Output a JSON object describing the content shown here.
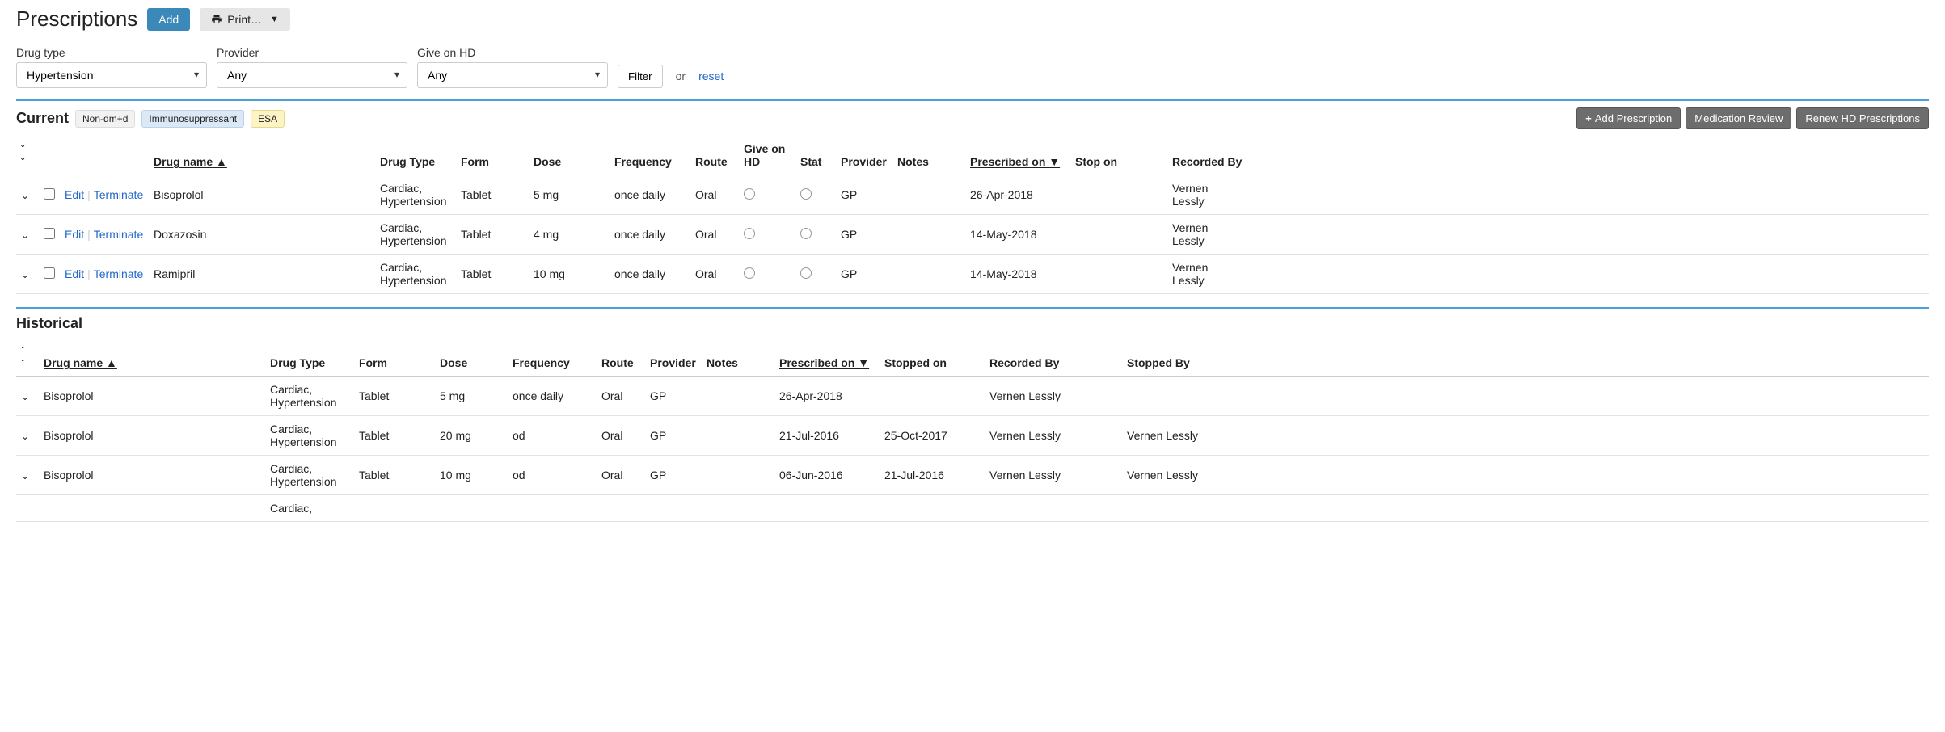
{
  "header": {
    "title": "Prescriptions",
    "add_label": "Add",
    "print_label": "Print…"
  },
  "filters": {
    "drug_type": {
      "label": "Drug type",
      "value": "Hypertension"
    },
    "provider": {
      "label": "Provider",
      "value": "Any"
    },
    "give_on_hd": {
      "label": "Give on HD",
      "value": "Any"
    },
    "filter_btn": "Filter",
    "or": "or",
    "reset": "reset"
  },
  "current": {
    "title": "Current",
    "pills": [
      "Non-dm+d",
      "Immunosuppressant",
      "ESA"
    ],
    "actions": {
      "add": "Add Prescription",
      "review": "Medication Review",
      "renew": "Renew HD Prescriptions"
    },
    "columns": {
      "drug_name": "Drug name ▲",
      "drug_type": "Drug Type",
      "form": "Form",
      "dose": "Dose",
      "frequency": "Frequency",
      "route": "Route",
      "give_on_hd": "Give on HD",
      "stat": "Stat",
      "provider": "Provider",
      "notes": "Notes",
      "prescribed_on": "Prescribed on ▼",
      "stop_on": "Stop on",
      "recorded_by": "Recorded By"
    },
    "row_actions": {
      "edit": "Edit",
      "terminate": "Terminate"
    },
    "rows": [
      {
        "name": "Bisoprolol",
        "type": "Cardiac, Hypertension",
        "form": "Tablet",
        "dose": "5 mg",
        "freq": "once daily",
        "route": "Oral",
        "provider": "GP",
        "prescribed": "26-Apr-2018",
        "recorded": "Vernen Lessly"
      },
      {
        "name": "Doxazosin",
        "type": "Cardiac, Hypertension",
        "form": "Tablet",
        "dose": "4 mg",
        "freq": "once daily",
        "route": "Oral",
        "provider": "GP",
        "prescribed": "14-May-2018",
        "recorded": "Vernen Lessly"
      },
      {
        "name": "Ramipril",
        "type": "Cardiac, Hypertension",
        "form": "Tablet",
        "dose": "10 mg",
        "freq": "once daily",
        "route": "Oral",
        "provider": "GP",
        "prescribed": "14-May-2018",
        "recorded": "Vernen Lessly"
      }
    ]
  },
  "historical": {
    "title": "Historical",
    "columns": {
      "drug_name": "Drug name ▲",
      "drug_type": "Drug Type",
      "form": "Form",
      "dose": "Dose",
      "frequency": "Frequency",
      "route": "Route",
      "provider": "Provider",
      "notes": "Notes",
      "prescribed_on": "Prescribed on ▼",
      "stopped_on": "Stopped on",
      "recorded_by": "Recorded By",
      "stopped_by": "Stopped By"
    },
    "rows": [
      {
        "name": "Bisoprolol",
        "type": "Cardiac, Hypertension",
        "form": "Tablet",
        "dose": "5 mg",
        "freq": "once daily",
        "route": "Oral",
        "provider": "GP",
        "prescribed": "26-Apr-2018",
        "stopped": "",
        "recorded": "Vernen Lessly",
        "stopped_by": ""
      },
      {
        "name": "Bisoprolol",
        "type": "Cardiac, Hypertension",
        "form": "Tablet",
        "dose": "20 mg",
        "freq": "od",
        "route": "Oral",
        "provider": "GP",
        "prescribed": "21-Jul-2016",
        "stopped": "25-Oct-2017",
        "recorded": "Vernen Lessly",
        "stopped_by": "Vernen Lessly"
      },
      {
        "name": "Bisoprolol",
        "type": "Cardiac, Hypertension",
        "form": "Tablet",
        "dose": "10 mg",
        "freq": "od",
        "route": "Oral",
        "provider": "GP",
        "prescribed": "06-Jun-2016",
        "stopped": "21-Jul-2016",
        "recorded": "Vernen Lessly",
        "stopped_by": "Vernen Lessly"
      }
    ],
    "partial_next_type": "Cardiac,"
  }
}
